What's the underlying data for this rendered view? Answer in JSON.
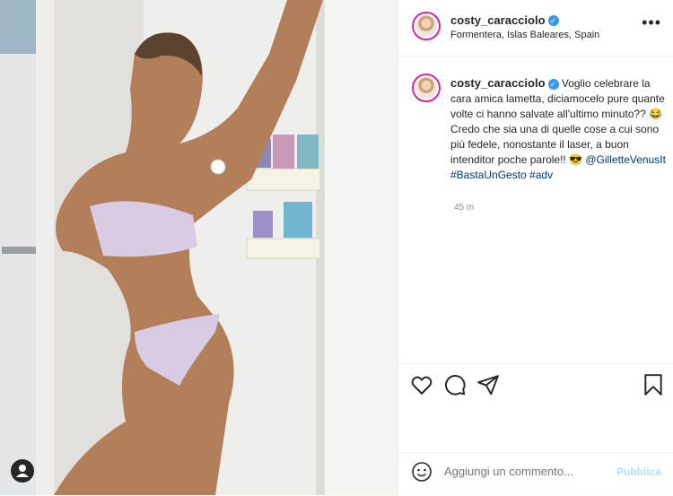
{
  "post": {
    "username": "costy_caracciolo",
    "location": "Formentera, Islas Baleares, Spain",
    "more_label": "•••",
    "caption": {
      "username": "costy_caracciolo",
      "text": "Voglio celebrare la cara amica lametta, diciamocelo pure quante volte ci hanno salvate all'ultimo minuto?? 😂Credo che sia una di quelle cose a cui sono più fedele, nonostante il laser, a buon intenditor poche parole!! 😎",
      "tags": "@GilletteVenusIt #BastaUnGesto #adv"
    },
    "time": "45 m"
  },
  "actions": {
    "like_icon": "heart-icon",
    "comment_icon": "comment-icon",
    "share_icon": "share-icon",
    "save_icon": "bookmark-icon"
  },
  "comment": {
    "placeholder": "Aggiungi un commento...",
    "publish_label": "Pubblica"
  },
  "colors": {
    "verified": "#3897f0",
    "link": "#00376b",
    "publish_disabled": "#b2dffc"
  }
}
